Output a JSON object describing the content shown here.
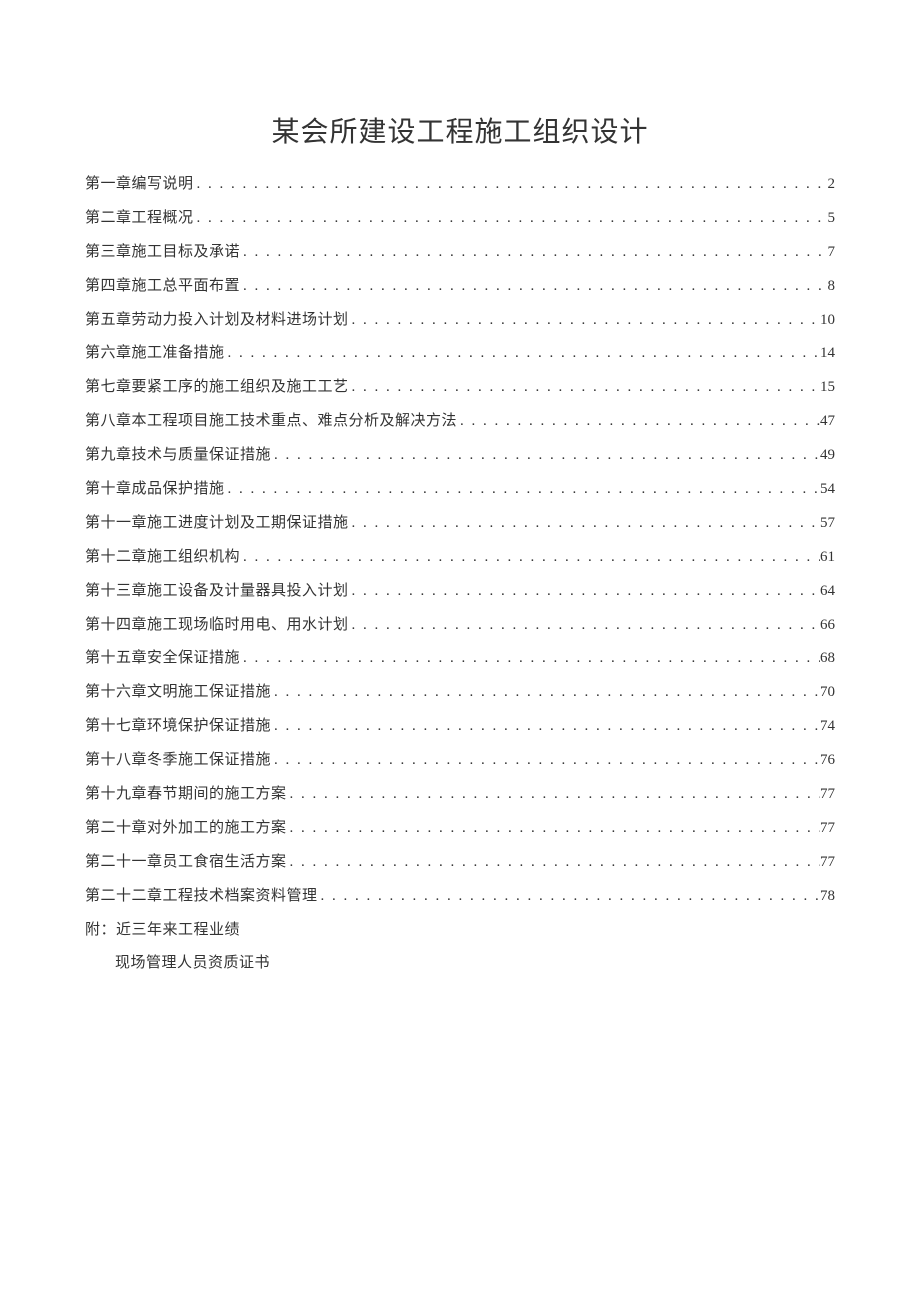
{
  "title": "某会所建设工程施工组织设计",
  "toc": [
    {
      "label": "第一章编写说明",
      "page": "2"
    },
    {
      "label": "第二章工程概况",
      "page": "5"
    },
    {
      "label": "第三章施工目标及承诺",
      "page": "7"
    },
    {
      "label": "第四章施工总平面布置",
      "page": "8"
    },
    {
      "label": "第五章劳动力投入计划及材料进场计划",
      "page": "10"
    },
    {
      "label": "第六章施工准备措施",
      "page": "14"
    },
    {
      "label": "第七章要紧工序的施工组织及施工工艺",
      "page": "15"
    },
    {
      "label": "第八章本工程项目施工技术重点、难点分析及解决方法",
      "page": "47"
    },
    {
      "label": "第九章技术与质量保证措施",
      "page": "49"
    },
    {
      "label": "第十章成品保护措施",
      "page": "54"
    },
    {
      "label": "第十一章施工进度计划及工期保证措施",
      "page": "57"
    },
    {
      "label": "第十二章施工组织机构",
      "page": "61"
    },
    {
      "label": "第十三章施工设备及计量器具投入计划",
      "page": "64"
    },
    {
      "label": "第十四章施工现场临时用电、用水计划",
      "page": "66"
    },
    {
      "label": "第十五章安全保证措施",
      "page": "68"
    },
    {
      "label": "第十六章文明施工保证措施",
      "page": "70"
    },
    {
      "label": "第十七章环境保护保证措施",
      "page": "74"
    },
    {
      "label": "第十八章冬季施工保证措施",
      "page": "76"
    },
    {
      "label": "第十九章春节期间的施工方案",
      "page": "77"
    },
    {
      "label": "第二十章对外加工的施工方案",
      "page": "77"
    },
    {
      "label": "第二十一章员工食宿生活方案",
      "page": "77"
    },
    {
      "label": "第二十二章工程技术档案资料管理",
      "page": "78"
    }
  ],
  "appendix": {
    "line1": "附：近三年来工程业绩",
    "line2": "现场管理人员资质证书"
  }
}
